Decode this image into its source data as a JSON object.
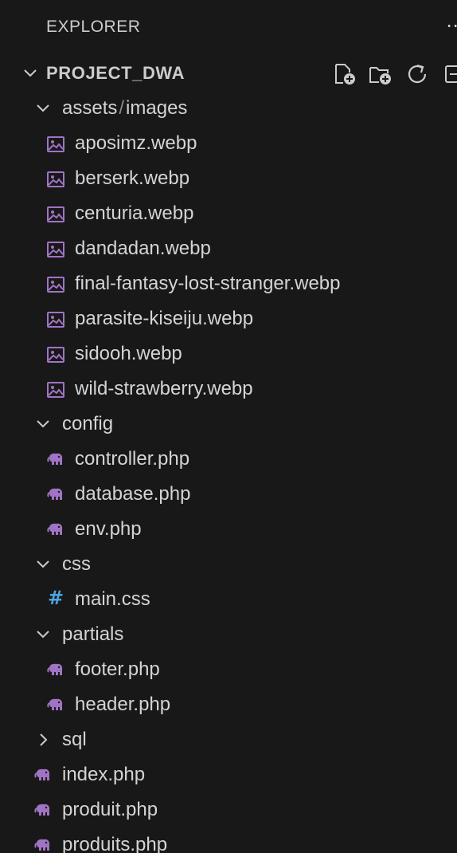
{
  "header": {
    "title": "EXPLORER",
    "more_icon": "more-icon"
  },
  "project": {
    "title": "PROJECT_DWA",
    "toolbar": [
      "new-file-icon",
      "new-folder-icon",
      "refresh-icon",
      "collapse-all-icon"
    ]
  },
  "tree": {
    "assets_folder": {
      "part1": "assets",
      "separator": "/",
      "part2": "images"
    },
    "image_files": [
      "aposimz.webp",
      "berserk.webp",
      "centuria.webp",
      "dandadan.webp",
      "final-fantasy-lost-stranger.webp",
      "parasite-kiseiju.webp",
      "sidooh.webp",
      "wild-strawberry.webp"
    ],
    "config_folder": "config",
    "config_files": [
      "controller.php",
      "database.php",
      "env.php"
    ],
    "css_folder": "css",
    "css_files": [
      "main.css"
    ],
    "partials_folder": "partials",
    "partials_files": [
      "footer.php",
      "header.php"
    ],
    "sql_folder": "sql",
    "root_files": [
      "index.php",
      "produit.php",
      "produits.php"
    ]
  },
  "colors": {
    "background": "#181818",
    "text": "#cccccc",
    "php_icon": "#a074c4",
    "css_icon": "#4fa3e0",
    "image_icon": "#a074c4"
  }
}
